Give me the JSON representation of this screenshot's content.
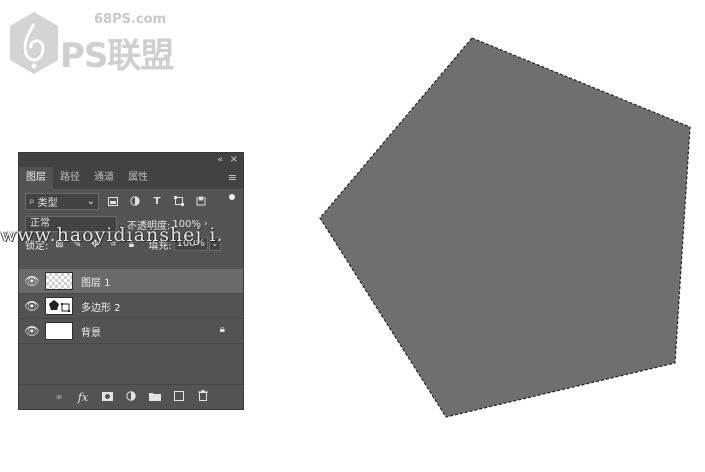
{
  "watermark": {
    "site": "68PS.com",
    "brand": "PS联盟",
    "url_overlay": "www.haoyidianshej i."
  },
  "canvas": {
    "shape_color": "#6f6f6f",
    "selection": "marching-ants"
  },
  "panel": {
    "collapse_icon": "«",
    "close_icon": "×",
    "tabs": [
      "图层",
      "路径",
      "通道",
      "属性"
    ],
    "active_tab": "图层",
    "menu_icon": "≡",
    "filter": {
      "kind_label": "类型",
      "icons": [
        "image-filter-icon",
        "adjustment-filter-icon",
        "type-filter-icon",
        "shape-filter-icon",
        "smart-object-filter-icon"
      ]
    },
    "blend": {
      "mode": "正常",
      "opacity_label": "不透明度:",
      "opacity_value": "100%"
    },
    "lock": {
      "label": "锁定:",
      "fill_label": "填充:",
      "fill_value": "100%"
    },
    "layers": [
      {
        "name": "图层 1",
        "thumb": "transparent",
        "selected": true,
        "visible": true,
        "locked": false
      },
      {
        "name": "多边形 2",
        "thumb": "shape",
        "selected": false,
        "visible": true,
        "locked": false
      },
      {
        "name": "背景",
        "thumb": "white",
        "selected": false,
        "visible": true,
        "locked": true
      }
    ],
    "bottom_icons": [
      "link-icon",
      "fx-icon",
      "mask-icon",
      "adjustment-icon",
      "folder-icon",
      "new-layer-icon",
      "trash-icon"
    ]
  }
}
